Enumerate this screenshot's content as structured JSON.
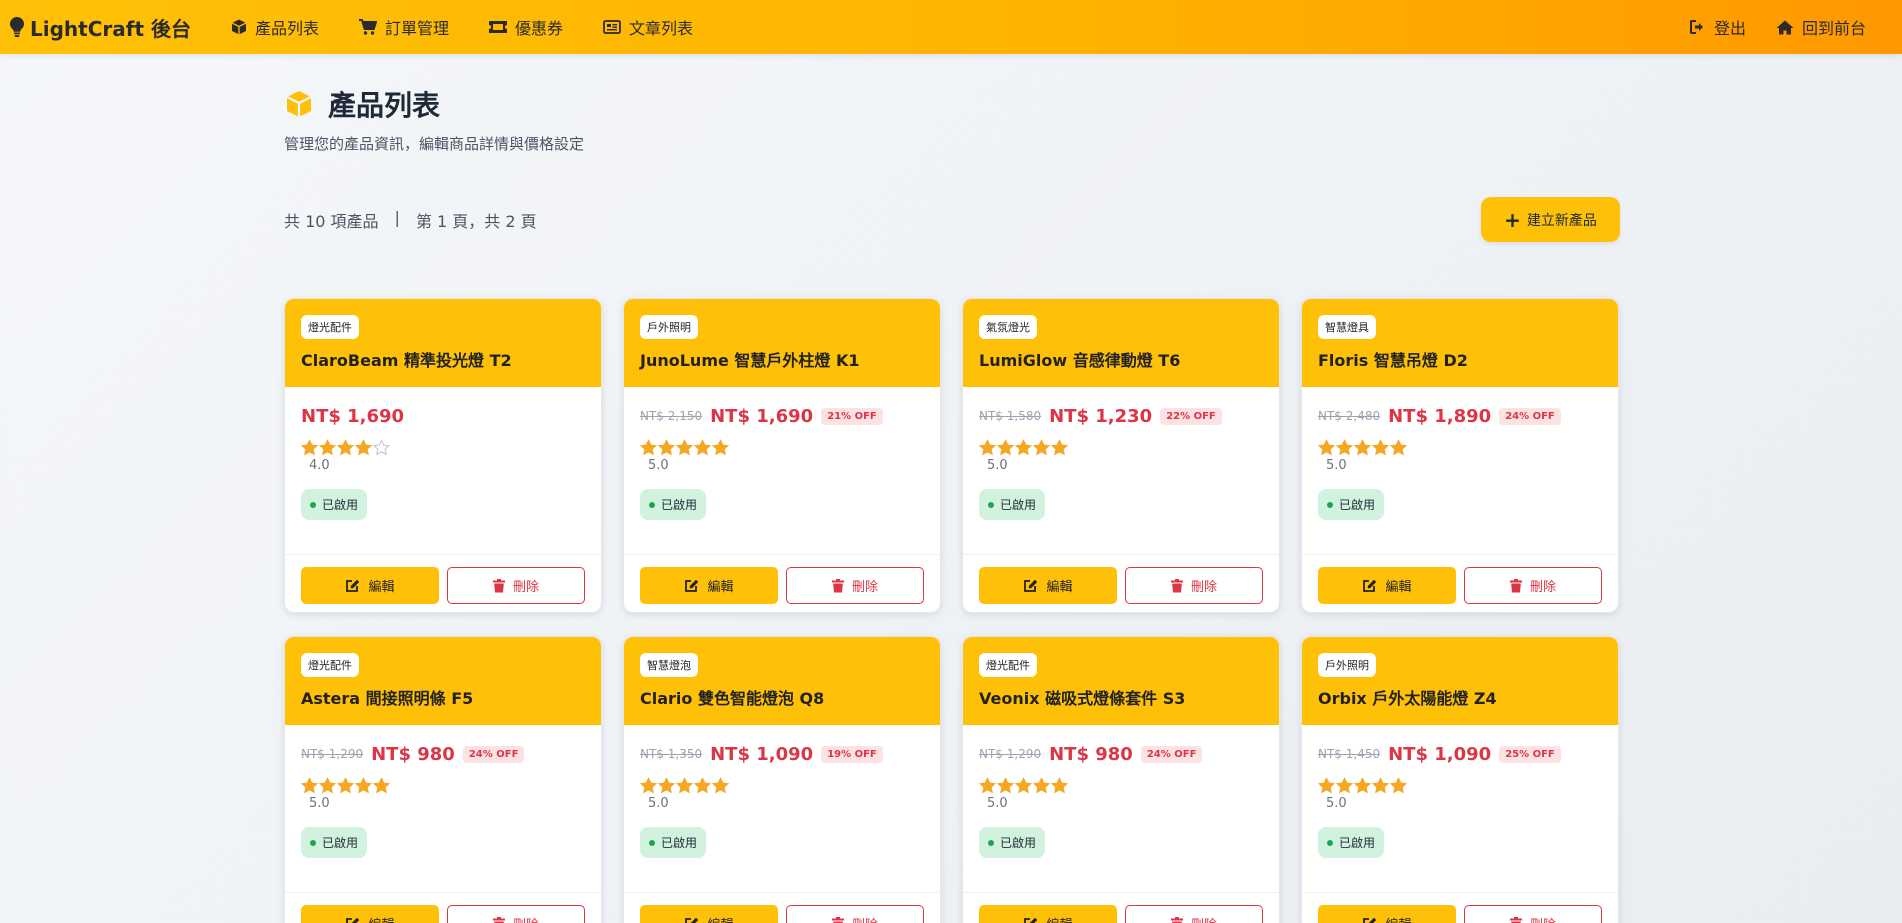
{
  "nav": {
    "brand": "LightCraft 後台",
    "links": [
      {
        "label": "產品列表",
        "icon": "cube-icon"
      },
      {
        "label": "訂單管理",
        "icon": "cart-icon"
      },
      {
        "label": "優惠券",
        "icon": "ticket-icon"
      },
      {
        "label": "文章列表",
        "icon": "newspaper-icon"
      }
    ],
    "logout": "登出",
    "home": "回到前台"
  },
  "header": {
    "title": "產品列表",
    "subtitle": "管理您的產品資訊，編輯商品詳情與價格設定"
  },
  "summary": {
    "total": "共 10 項產品",
    "sep": "|",
    "page": "第 1 頁，共 2 頁"
  },
  "create_button": "建立新產品",
  "actions": {
    "edit": "編輯",
    "delete": "刪除"
  },
  "colors": {
    "accent": "#ffc107",
    "price": "#dc3545",
    "status_bg": "#d1f2de"
  },
  "products": [
    {
      "category": "燈光配件",
      "name": "ClaroBeam 精準投光燈 T2",
      "orig": "",
      "price": "NT$ 1,690",
      "off": "",
      "stars": 4,
      "rating": "4.0",
      "status": "已啟用"
    },
    {
      "category": "戶外照明",
      "name": "JunoLume 智慧戶外柱燈 K1",
      "orig": "NT$ 2,150",
      "price": "NT$ 1,690",
      "off": "21% OFF",
      "stars": 5,
      "rating": "5.0",
      "status": "已啟用"
    },
    {
      "category": "氣氛燈光",
      "name": "LumiGlow 音感律動燈 T6",
      "orig": "NT$ 1,580",
      "price": "NT$ 1,230",
      "off": "22% OFF",
      "stars": 5,
      "rating": "5.0",
      "status": "已啟用"
    },
    {
      "category": "智慧燈具",
      "name": "Floris 智慧吊燈 D2",
      "orig": "NT$ 2,480",
      "price": "NT$ 1,890",
      "off": "24% OFF",
      "stars": 5,
      "rating": "5.0",
      "status": "已啟用"
    },
    {
      "category": "燈光配件",
      "name": "Astera 間接照明條 F5",
      "orig": "NT$ 1,290",
      "price": "NT$ 980",
      "off": "24% OFF",
      "stars": 5,
      "rating": "5.0",
      "status": "已啟用"
    },
    {
      "category": "智慧燈泡",
      "name": "Clario 雙色智能燈泡 Q8",
      "orig": "NT$ 1,350",
      "price": "NT$ 1,090",
      "off": "19% OFF",
      "stars": 5,
      "rating": "5.0",
      "status": "已啟用"
    },
    {
      "category": "燈光配件",
      "name": "Veonix 磁吸式燈條套件 S3",
      "orig": "NT$ 1,290",
      "price": "NT$ 980",
      "off": "24% OFF",
      "stars": 5,
      "rating": "5.0",
      "status": "已啟用"
    },
    {
      "category": "戶外照明",
      "name": "Orbix 戶外太陽能燈 Z4",
      "orig": "NT$ 1,450",
      "price": "NT$ 1,090",
      "off": "25% OFF",
      "stars": 5,
      "rating": "5.0",
      "status": "已啟用"
    }
  ]
}
